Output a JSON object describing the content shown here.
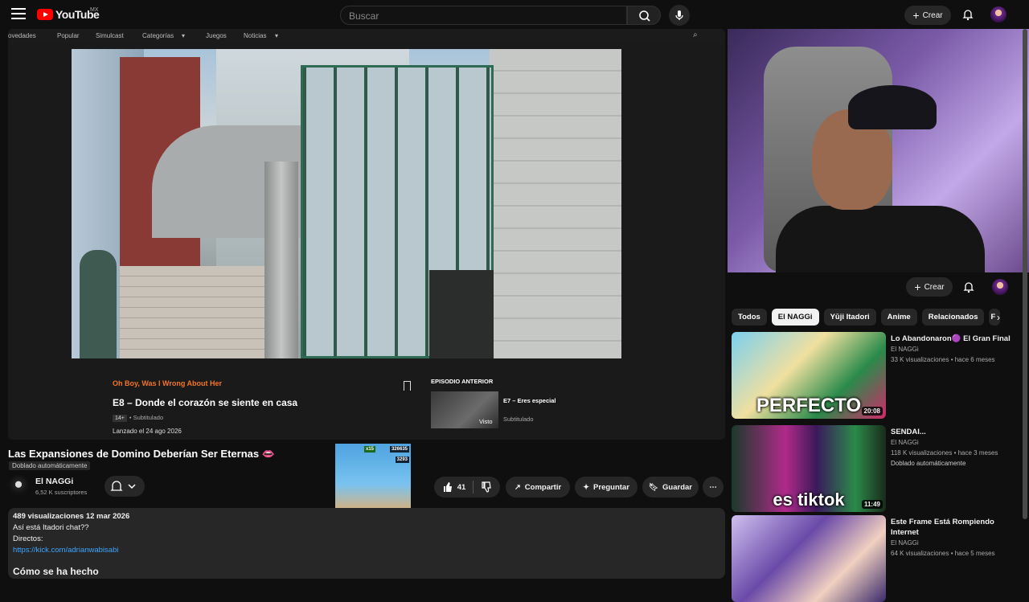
{
  "header": {
    "logo_text": "YouTube",
    "region": "MX",
    "search_placeholder": "Buscar",
    "create_label": "Crear"
  },
  "crunchy_nav": {
    "items": [
      "ovedades",
      "Popular",
      "Simulcast",
      "Categorías",
      "Juegos",
      "Noticias"
    ]
  },
  "episode": {
    "series": "Oh Boy, Was I Wrong About Her",
    "title": "E8 – Donde el corazón se siente en casa",
    "rating": "14+",
    "subtitle_info": "• Subtitulado",
    "release": "Lanzado el 24 ago 2026",
    "prev_label": "EPISODIO ANTERIOR",
    "prev_title": "E7 – Eres especial",
    "prev_sub": "Subtitulado",
    "prev_seen": "Visto"
  },
  "video": {
    "title": "Las Expansiones de Domino Deberían Ser Eternas 👄",
    "dubbed": "Doblado automáticamente",
    "channel": "El NAGGi",
    "subscribers": "6,52 K suscriptores",
    "likes": "41",
    "share": "Compartir",
    "ask": "Preguntar",
    "save": "Guardar"
  },
  "description": {
    "stats": "489 visualizaciones  12 mar 2026",
    "line1": "Así está Itadori chat??",
    "line2": "Directos:",
    "link": "https://kick.com/adrianwabisabi",
    "heading": "Cómo se ha hecho"
  },
  "game_overlay": {
    "score": "326635",
    "coins": "3293",
    "multiplier": "x15"
  },
  "right_header": {
    "create_label": "Crear"
  },
  "chips": [
    "Todos",
    "El NAGGi",
    "Yūji Itadori",
    "Anime",
    "Relacionados",
    "F"
  ],
  "recommendations": [
    {
      "title": "Lo Abandonaron🟣 El Gran Final",
      "channel": "El NAGGi",
      "meta": "33 K visualizaciones • hace 6 meses",
      "duration": "20:08",
      "thumb_text": "PERFECTO"
    },
    {
      "title": "SENDAI...",
      "channel": "El NAGGi",
      "meta": "118 K visualizaciones • hace 3 meses",
      "badge": "Doblado automáticamente",
      "duration": "11:49",
      "thumb_text": "es tiktok"
    },
    {
      "title": "Este Frame Está Rompiendo Internet",
      "channel": "El NAGGi",
      "meta": "64 K visualizaciones • hace 5 meses"
    }
  ],
  "colors": {
    "bg": "#0f0f0f",
    "accent_red": "#ff0000",
    "crunchy_orange": "#f47521",
    "link": "#3ea6ff"
  }
}
